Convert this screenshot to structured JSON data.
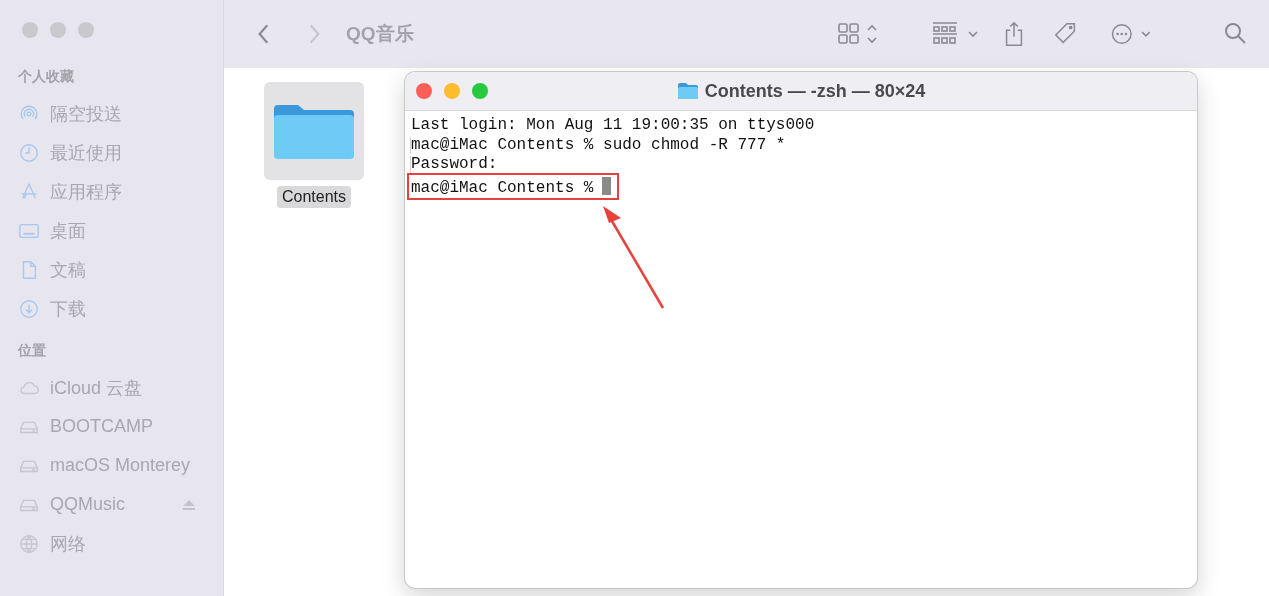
{
  "finder": {
    "title": "QQ音乐",
    "sidebar": [
      {
        "heading": "个人收藏",
        "items": [
          {
            "label": "隔空投送",
            "kind": "airdrop"
          },
          {
            "label": "最近使用",
            "kind": "clock"
          },
          {
            "label": "应用程序",
            "kind": "apps"
          },
          {
            "label": "桌面",
            "kind": "desktop"
          },
          {
            "label": "文稿",
            "kind": "document"
          },
          {
            "label": "下载",
            "kind": "download"
          }
        ]
      },
      {
        "heading": "位置",
        "items": [
          {
            "label": "iCloud 云盘",
            "kind": "cloud"
          },
          {
            "label": "BOOTCAMP",
            "kind": "drive"
          },
          {
            "label": "macOS Monterey",
            "kind": "drive"
          },
          {
            "label": "QQMusic",
            "kind": "drive",
            "ejectable": true
          },
          {
            "label": "网络",
            "kind": "globe"
          }
        ]
      }
    ],
    "files": [
      {
        "name": "Contents",
        "selected": true
      }
    ]
  },
  "terminal": {
    "title": "Contents — -zsh — 80×24",
    "lines": [
      {
        "text": "Last login: Mon Aug 11 19:00:35 on ttys000",
        "marked": false,
        "highlighted": false,
        "cursor": false
      },
      {
        "text": "mac@iMac Contents % sudo chmod -R 777 *",
        "marked": true,
        "highlighted": false,
        "cursor": false
      },
      {
        "text": "Password:",
        "marked": true,
        "highlighted": false,
        "cursor": false
      },
      {
        "text": "mac@iMac Contents %",
        "marked": false,
        "highlighted": true,
        "cursor": true
      }
    ]
  }
}
